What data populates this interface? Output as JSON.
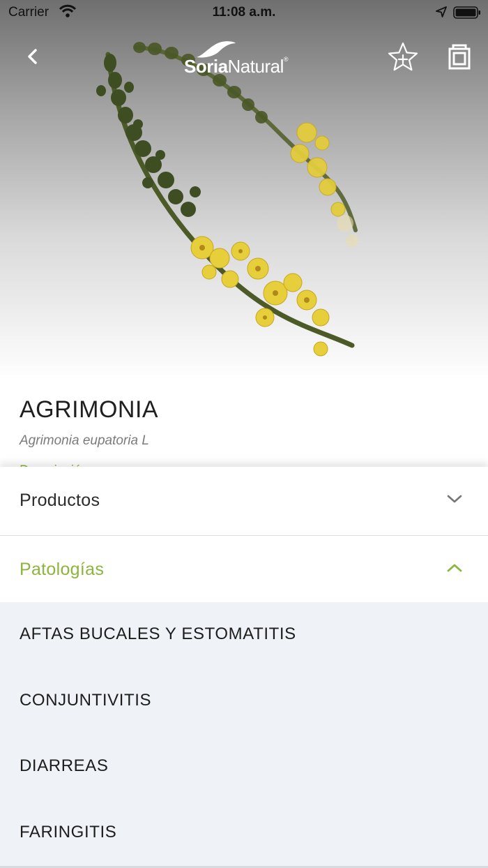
{
  "status_bar": {
    "carrier": "Carrier",
    "time": "11:08 a.m.",
    "icons": [
      "wifi-icon",
      "location-arrow-icon",
      "battery-icon"
    ]
  },
  "header": {
    "logo_bold": "Soria",
    "logo_rest": "Natural",
    "logo_mark": "®",
    "icons": [
      "back-chevron-icon",
      "star-plus-icon",
      "gallery-icon"
    ]
  },
  "plant": {
    "name": "AGRIMONIA",
    "scientific_name": "Agrimonia eupatoria L",
    "description_label": "Descripción"
  },
  "accordion": {
    "products_label": "Productos",
    "pathologies_label": "Patologías",
    "pathologies": [
      "AFTAS BUCALES Y ESTOMATITIS",
      "CONJUNTIVITIS",
      "DIARREAS",
      "FARINGITIS"
    ]
  },
  "colors": {
    "accent_green": "#8bb53d",
    "list_background": "#eff2f6"
  }
}
